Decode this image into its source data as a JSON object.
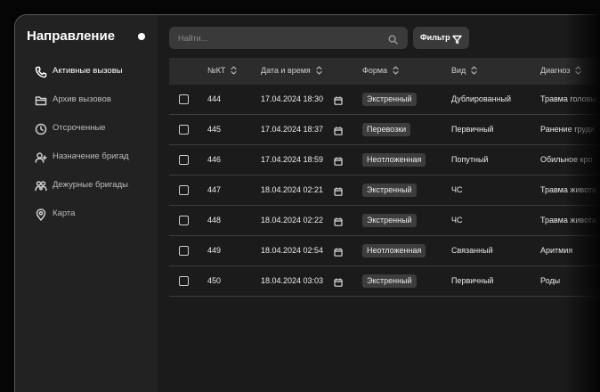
{
  "sidebar": {
    "title": "Направление",
    "items": [
      {
        "label": "Активные вызовы",
        "icon": "phone-icon",
        "active": true
      },
      {
        "label": "Архив вызовов",
        "icon": "folder-icon",
        "active": false
      },
      {
        "label": "Отсроченные",
        "icon": "clock-icon",
        "active": false
      },
      {
        "label": "Назначение бригад",
        "icon": "user-plus-icon",
        "active": false
      },
      {
        "label": "Дежурные бригады",
        "icon": "users-icon",
        "active": false
      },
      {
        "label": "Карта",
        "icon": "map-pin-icon",
        "active": false
      }
    ]
  },
  "toolbar": {
    "search_placeholder": "Найти...",
    "filter_label": "Фильтр"
  },
  "table": {
    "columns": [
      "№КТ",
      "Дата и время",
      "Форма",
      "Вид",
      "Диагноз"
    ],
    "rows": [
      {
        "id": "444",
        "datetime": "17.04.2024 18:30",
        "form": "Экстренный",
        "type": "Дублированный",
        "diagnosis": "Травма головы"
      },
      {
        "id": "445",
        "datetime": "17.04.2024 18:37",
        "form": "Перевозки",
        "type": "Первичный",
        "diagnosis": "Ранение груди"
      },
      {
        "id": "446",
        "datetime": "17.04.2024 18:59",
        "form": "Неотложенная",
        "type": "Попутный",
        "diagnosis": "Обильное кро"
      },
      {
        "id": "447",
        "datetime": "18.04.2024 02:21",
        "form": "Экстренный",
        "type": "ЧС",
        "diagnosis": "Травма живота"
      },
      {
        "id": "448",
        "datetime": "18.04.2024 02:22",
        "form": "Экстренный",
        "type": "ЧС",
        "diagnosis": "Травма живота"
      },
      {
        "id": "449",
        "datetime": "18.04.2024 02:54",
        "form": "Неотложенная",
        "type": "Связанный",
        "diagnosis": "Аритмия"
      },
      {
        "id": "450",
        "datetime": "18.04.2024 03:03",
        "form": "Экстренный",
        "type": "Первичный",
        "diagnosis": "Роды"
      }
    ]
  },
  "colors": {
    "background": "#050505",
    "panel": "#1b1b1b",
    "sidebar": "#222222",
    "header_row": "#2c2c2c",
    "badge": "#3d3d3d"
  }
}
